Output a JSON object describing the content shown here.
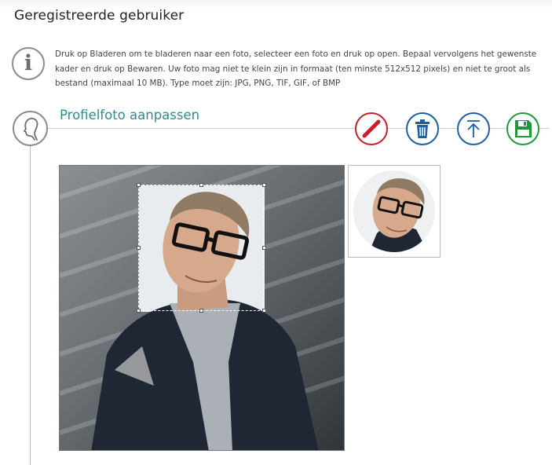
{
  "header": {
    "title": "Geregistreerde gebruiker"
  },
  "info": {
    "icon": "info-icon",
    "text": "Druk op Bladeren om te bladeren naar een foto, selecteer een foto en druk op open. Bepaal vervolgens het gewenste kader en druk op Bewaren. Uw foto mag niet te klein zijn in formaat (ten minste 512x512 pixels) en niet te groot als bestand (maximaal 10 MB). Type moet zijn: JPG, PNG, TIF, GIF, of BMP"
  },
  "section": {
    "icon": "profile-head-icon",
    "title": "Profielfoto aanpassen"
  },
  "toolbar": {
    "edit": {
      "icon": "pencil-icon",
      "color": "#c8202b"
    },
    "delete": {
      "icon": "trash-icon",
      "color": "#1f5fa0"
    },
    "upload": {
      "icon": "upload-icon",
      "color": "#1f5fa0"
    },
    "save": {
      "icon": "floppy-disk-icon",
      "color": "#1e9a3c"
    }
  },
  "photo": {
    "subject": "portrait-photo",
    "crop": "crop-selection"
  },
  "preview": {
    "subject": "avatar-preview"
  },
  "colors": {
    "accent": "#2c8c8f",
    "border": "#8c8c8c"
  }
}
